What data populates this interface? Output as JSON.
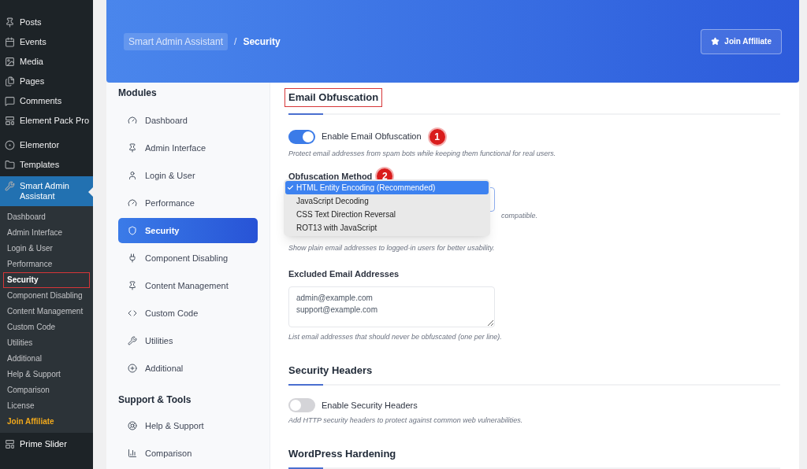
{
  "wp_menu": [
    {
      "label": "Posts",
      "selected": false
    },
    {
      "label": "Events",
      "selected": false
    },
    {
      "label": "Media",
      "selected": false
    },
    {
      "label": "Pages",
      "selected": false
    },
    {
      "label": "Comments",
      "selected": false
    },
    {
      "label": "Element Pack Pro",
      "selected": false
    },
    {
      "label": "Elementor",
      "selected": false
    },
    {
      "label": "Templates",
      "selected": false
    },
    {
      "label": "Smart Admin Assistant",
      "selected": true
    }
  ],
  "wp_submenu": [
    {
      "label": "Dashboard",
      "selected": false,
      "kind": "normal"
    },
    {
      "label": "Admin Interface",
      "selected": false,
      "kind": "normal"
    },
    {
      "label": "Login & User",
      "selected": false,
      "kind": "normal"
    },
    {
      "label": "Performance",
      "selected": false,
      "kind": "normal"
    },
    {
      "label": "Security",
      "selected": true,
      "kind": "normal"
    },
    {
      "label": "Component Disabling",
      "selected": false,
      "kind": "normal"
    },
    {
      "label": "Content Management",
      "selected": false,
      "kind": "normal"
    },
    {
      "label": "Custom Code",
      "selected": false,
      "kind": "normal"
    },
    {
      "label": "Utilities",
      "selected": false,
      "kind": "normal"
    },
    {
      "label": "Additional",
      "selected": false,
      "kind": "normal"
    },
    {
      "label": "Help & Support",
      "selected": false,
      "kind": "normal"
    },
    {
      "label": "Comparison",
      "selected": false,
      "kind": "normal"
    },
    {
      "label": "License",
      "selected": false,
      "kind": "normal"
    },
    {
      "label": "Join Affiliate",
      "selected": false,
      "kind": "highlight"
    }
  ],
  "wp_menu_bottom": {
    "label": "Prime Slider"
  },
  "header": {
    "breadcrumb": [
      "Smart Admin Assistant",
      "Security"
    ],
    "separator": "/",
    "button": "Join Affiliate"
  },
  "modules": {
    "groups": [
      {
        "title": "Modules",
        "items": [
          {
            "label": "Dashboard",
            "selected": false
          },
          {
            "label": "Admin Interface",
            "selected": false
          },
          {
            "label": "Login & User",
            "selected": false
          },
          {
            "label": "Performance",
            "selected": false
          },
          {
            "label": "Security",
            "selected": true
          },
          {
            "label": "Component Disabling",
            "selected": false
          },
          {
            "label": "Content Management",
            "selected": false
          },
          {
            "label": "Custom Code",
            "selected": false
          },
          {
            "label": "Utilities",
            "selected": false
          },
          {
            "label": "Additional",
            "selected": false
          }
        ]
      },
      {
        "title": "Support & Tools",
        "items": [
          {
            "label": "Help & Support",
            "selected": false
          },
          {
            "label": "Comparison",
            "selected": false
          }
        ]
      }
    ]
  },
  "content": {
    "email_section": {
      "title": "Email Obfuscation",
      "toggle": {
        "label": "Enable Email Obfuscation",
        "on": true,
        "marker": "1"
      },
      "toggle_help": "Protect email addresses from spam bots while keeping them functional for real users.",
      "method_label": "Obfuscation Method",
      "method_marker": "2",
      "method_options": [
        {
          "label": "HTML Entity Encoding (Recommended)",
          "selected": true
        },
        {
          "label": "JavaScript Decoding",
          "selected": false
        },
        {
          "label": "CSS Text Direction Reversal",
          "selected": false
        },
        {
          "label": "ROT13 with JavaScript",
          "selected": false
        }
      ],
      "method_help_tail": "compatible.",
      "logged_in_help": "Show plain email addresses to logged-in users for better usability.",
      "excluded_label": "Excluded Email Addresses",
      "excluded_value": "admin@example.com\nsupport@example.com",
      "excluded_help": "List email addresses that should never be obfuscated (one per line)."
    },
    "headers_section": {
      "title": "Security Headers",
      "toggle": {
        "label": "Enable Security Headers",
        "on": false
      },
      "help": "Add HTTP security headers to protect against common web vulnerabilities."
    },
    "hardening_section": {
      "title": "WordPress Hardening"
    }
  }
}
